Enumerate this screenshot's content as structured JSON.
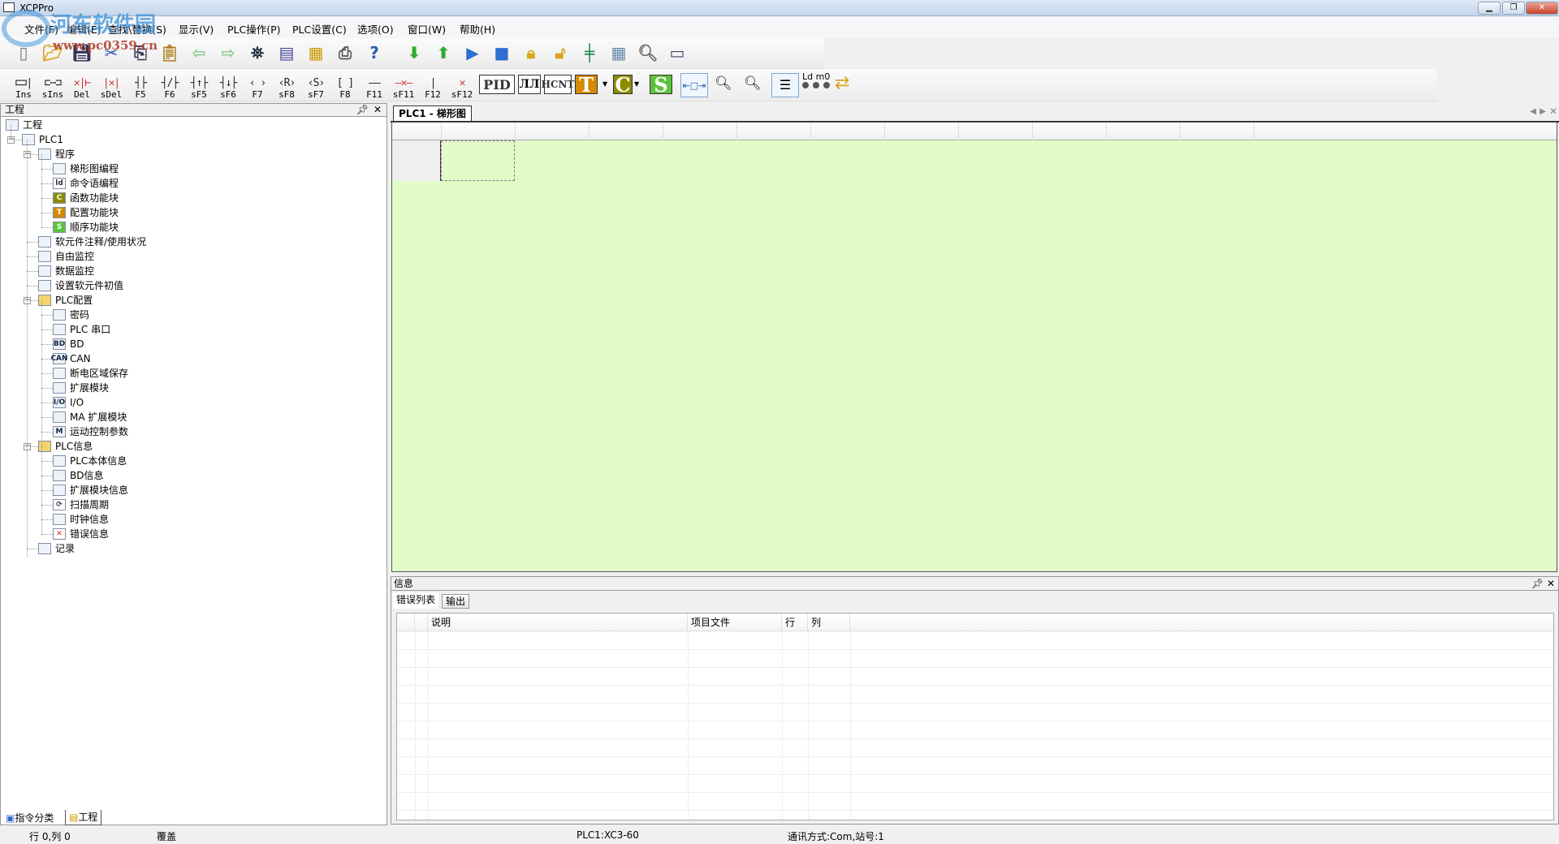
{
  "window": {
    "title": "XCPPro"
  },
  "watermark": {
    "site_name": "河东软件园",
    "url": "www.pc0359.cn"
  },
  "menu": [
    "文件(F)",
    "编辑(E)",
    "查找\\替换(S)",
    "显示(V)",
    "PLC操作(P)",
    "PLC设置(C)",
    "选项(O)",
    "窗口(W)",
    "帮助(H)"
  ],
  "toolbar1": [
    "new-file",
    "open-folder",
    "save",
    "cut",
    "copy",
    "paste",
    "back",
    "forward",
    "find",
    "print-preview",
    "document",
    "print",
    "help",
    "download-to-plc",
    "upload-from-plc",
    "run",
    "stop",
    "lock",
    "unlock",
    "ladder-monitor",
    "data-monitor",
    "document-search",
    "serial-port"
  ],
  "toolbar2": [
    {
      "glyph": "⊏⊐|",
      "label": "Ins"
    },
    {
      "glyph": "⊏⋯⊐",
      "label": "sIns"
    },
    {
      "glyph": "✕|⊢",
      "label": "Del"
    },
    {
      "glyph": "|✕|",
      "label": "sDel"
    },
    {
      "glyph": "┤├",
      "label": "F5"
    },
    {
      "glyph": "┤/├",
      "label": "F6"
    },
    {
      "glyph": "┤↑├",
      "label": "sF5"
    },
    {
      "glyph": "┤↓├",
      "label": "sF6"
    },
    {
      "glyph": "‹ ›",
      "label": "F7"
    },
    {
      "glyph": "‹R›",
      "label": "sF8"
    },
    {
      "glyph": "‹S›",
      "label": "sF7"
    },
    {
      "glyph": "[ ]",
      "label": "F8"
    },
    {
      "glyph": "——",
      "label": "F11"
    },
    {
      "glyph": "—✕—",
      "label": "sF11"
    },
    {
      "glyph": "|",
      "label": "F12"
    },
    {
      "glyph": "✕",
      "label": "sF12"
    }
  ],
  "toolbar2_blocks": {
    "pid": "PID",
    "hcnt": "HCNT",
    "t": "T",
    "c": "C",
    "s": "S",
    "ld": "Ld m0"
  },
  "colors": {
    "ladder_bg": "#e2fcc8",
    "t_block": "#d58a00",
    "c_block": "#8c8c00",
    "s_block": "#5cc33a"
  },
  "left_panel": {
    "title": "工程",
    "bottom_tabs": [
      "指令分类",
      "工程"
    ],
    "tree": [
      {
        "label": "工程",
        "level": 0,
        "icon": "project-icon"
      },
      {
        "label": "PLC1",
        "level": 1,
        "icon": "plc-icon",
        "expanded": true
      },
      {
        "label": "程序",
        "level": 2,
        "icon": "page-icon",
        "expanded": true
      },
      {
        "label": "梯形图编程",
        "level": 3,
        "icon": "ladder-icon"
      },
      {
        "label": "命令语编程",
        "level": 3,
        "icon": "instruction-icon"
      },
      {
        "label": "函数功能块",
        "level": 3,
        "icon": "c-block-icon"
      },
      {
        "label": "配置功能块",
        "level": 3,
        "icon": "t-block-icon"
      },
      {
        "label": "顺序功能块",
        "level": 3,
        "icon": "s-block-icon"
      },
      {
        "label": "软元件注释/使用状况",
        "level": 2,
        "icon": "list-icon"
      },
      {
        "label": "自由监控",
        "level": 2,
        "icon": "free-monitor-icon"
      },
      {
        "label": "数据监控",
        "level": 2,
        "icon": "data-monitor-icon"
      },
      {
        "label": "设置软元件初值",
        "level": 2,
        "icon": "init-value-icon"
      },
      {
        "label": "PLC配置",
        "level": 2,
        "icon": "folder-icon",
        "expanded": true
      },
      {
        "label": "密码",
        "level": 3,
        "icon": "password-icon"
      },
      {
        "label": "PLC 串口",
        "level": 3,
        "icon": "serial-icon"
      },
      {
        "label": "BD",
        "level": 3,
        "icon": "bd-icon"
      },
      {
        "label": "CAN",
        "level": 3,
        "icon": "can-icon"
      },
      {
        "label": "断电区域保存",
        "level": 3,
        "icon": "power-save-icon"
      },
      {
        "label": "扩展模块",
        "level": 3,
        "icon": "expansion-icon"
      },
      {
        "label": "I/O",
        "level": 3,
        "icon": "io-icon"
      },
      {
        "label": "MA 扩展模块",
        "level": 3,
        "icon": "ma-expansion-icon"
      },
      {
        "label": "运动控制参数",
        "level": 3,
        "icon": "motion-icon"
      },
      {
        "label": "PLC信息",
        "level": 2,
        "icon": "folder-icon",
        "expanded": true
      },
      {
        "label": "PLC本体信息",
        "level": 3,
        "icon": "info-icon"
      },
      {
        "label": "BD信息",
        "level": 3,
        "icon": "bd-info-icon"
      },
      {
        "label": "扩展模块信息",
        "level": 3,
        "icon": "expansion-info-icon"
      },
      {
        "label": "扫描周期",
        "level": 3,
        "icon": "refresh-icon"
      },
      {
        "label": "时钟信息",
        "level": 3,
        "icon": "clock-icon"
      },
      {
        "label": "错误信息",
        "level": 3,
        "icon": "error-icon"
      },
      {
        "label": "记录",
        "level": 2,
        "icon": "record-icon"
      }
    ]
  },
  "document": {
    "tab": "PLC1 - 梯形图"
  },
  "info_panel": {
    "title": "信息",
    "tabs": [
      "错误列表",
      "输出"
    ],
    "columns": [
      "说明",
      "项目文件",
      "行",
      "列"
    ]
  },
  "status": {
    "position": "行 0,列 0",
    "mode": "覆盖",
    "plc": "PLC1:XC3-60",
    "comm": "通讯方式:Com,站号:1"
  }
}
